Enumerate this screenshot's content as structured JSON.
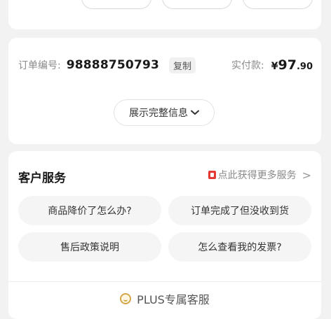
{
  "order": {
    "number_label": "订单编号:",
    "number": "98888750793",
    "copy_label": "复制",
    "paid_label": "实付款:",
    "price_symbol": "¥",
    "price_int": "97",
    "price_dec": ".90",
    "expand_label": "展示完整信息"
  },
  "service": {
    "title": "客户服务",
    "more_label": "点此获得更多服务",
    "more_chevron": ">",
    "questions": [
      "商品降价了怎么办?",
      "订单完成了但没收到货",
      "售后政策说明",
      "怎么查看我的发票?"
    ],
    "plus_label": "PLUS专属客服"
  },
  "icons": {
    "expand": "chevron-down-icon",
    "more": "red-flag-icon",
    "plus": "smiley-badge-icon"
  },
  "colors": {
    "page_bg": "#f2f2f2",
    "card_bg": "#ffffff",
    "accent_red": "#e53935",
    "plus_gold": "#d4a64a"
  }
}
